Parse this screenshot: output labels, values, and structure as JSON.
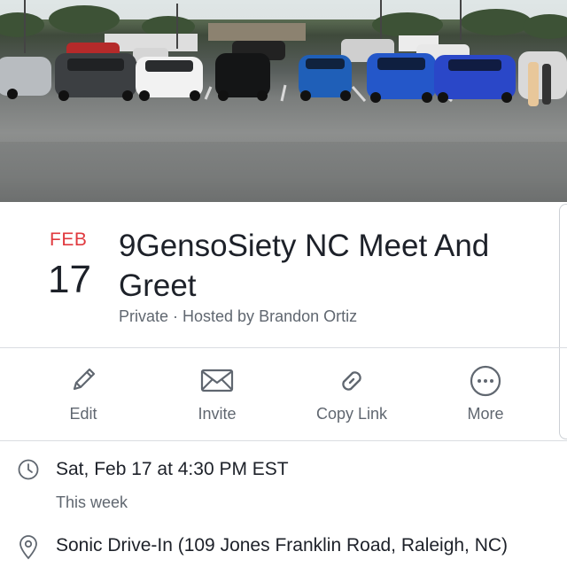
{
  "cover": {
    "description_icon": "event-cover-photo"
  },
  "event": {
    "month": "FEB",
    "day": "17",
    "title": "9GensoSiety NC Meet And Greet",
    "subtitle": "Private · Hosted by Brandon Ortiz"
  },
  "actions": [
    {
      "label": "Edit",
      "icon": "pencil-icon"
    },
    {
      "label": "Invite",
      "icon": "envelope-icon"
    },
    {
      "label": "Copy Link",
      "icon": "link-icon"
    },
    {
      "label": "More",
      "icon": "more-icon"
    }
  ],
  "details": {
    "time": "Sat, Feb 17 at 4:30 PM EST",
    "time_sub": "This week",
    "location": "Sonic Drive-In (109 Jones Franklin Road, Raleigh, NC)"
  },
  "colors": {
    "accent_red": "#e0393e",
    "text_primary": "#1d2129",
    "text_secondary": "#606770",
    "icon_gray": "#606770"
  }
}
